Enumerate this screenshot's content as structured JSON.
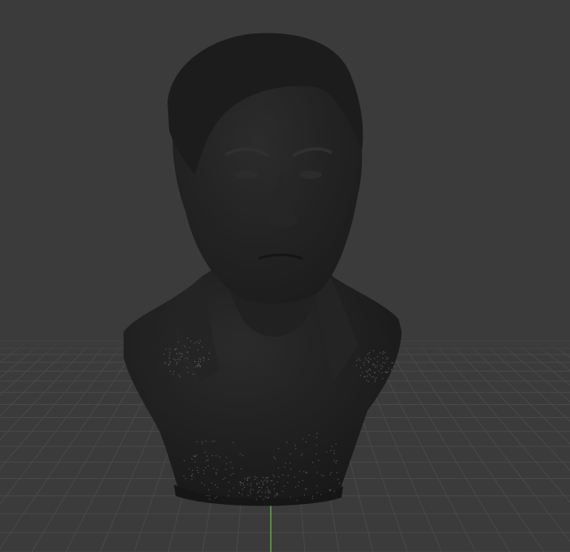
{
  "viewport": {
    "background_color": "#3b3b3b",
    "grid_color": "#4a4a4a",
    "grid_major_color": "#525252",
    "axis_y_color": "#5fa84a",
    "model_color": "#1e1e1e",
    "model_highlight_color": "#2a2a2a",
    "speckle_color": "#8a8a8a"
  },
  "model": {
    "subject": "sculpted-bust",
    "icon": "bust-icon"
  }
}
